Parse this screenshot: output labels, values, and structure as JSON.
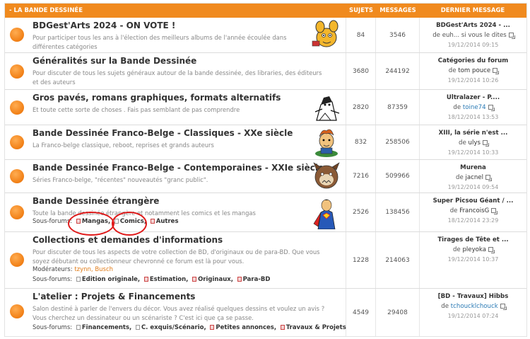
{
  "header": {
    "title": "- LA BANDE DESSINÉE",
    "col_sujets": "SUJETS",
    "col_messages": "MESSAGES",
    "col_last": "DERNIER MESSAGE"
  },
  "forums": [
    {
      "title": "BDGest'Arts 2024 - ON VOTE !",
      "desc": "Pour participer tous les ans à l'élection des meilleurs albums de l'année écoulée dans différentes catégories",
      "sujets": "84",
      "messages": "3546",
      "last_title": "BDGest'Arts 2024 - ...",
      "last_by": "de euh... si vous le dites",
      "last_date": "19/12/2014 09:15"
    },
    {
      "title": "Généralités sur la Bande Dessinée",
      "desc": "Pour discuter de tous les sujets généraux autour de la bande dessinée, des libraries, des éditeurs et des auteurs",
      "sujets": "3680",
      "messages": "244192",
      "last_title": "Catégories du forum",
      "last_prefix": "de",
      "last_user": "tom pouce",
      "last_date": "19/12/2014 10:26"
    },
    {
      "title": "Gros pavés, romans graphiques, formats alternatifs",
      "desc": "Et toute cette sorte de choses . Fais pas semblant de pas comprendre",
      "sujets": "2820",
      "messages": "87359",
      "last_title": "Ultralazer - P....",
      "last_prefix": "de",
      "last_user": "toine74",
      "last_date": "18/12/2014 13:53"
    },
    {
      "title": "Bande Dessinée Franco-Belge - Classiques - XXe siècle",
      "desc": "La Franco-belge classique, reboot, reprises et grands auteurs",
      "sujets": "832",
      "messages": "258506",
      "last_title": "XIII, la série n'est ...",
      "last_prefix": "de",
      "last_user": "ulys",
      "last_date": "19/12/2014 10:33"
    },
    {
      "title": "Bande Dessinée Franco-Belge - Contemporaines - XXIe siècle",
      "desc": "Séries Franco-belge, \"récentes\" nouveautés \"granc public\".",
      "sujets": "7216",
      "messages": "509966",
      "last_title": "Murena",
      "last_prefix": "de",
      "last_user": "jacnel",
      "last_date": "19/12/2014 09:54"
    },
    {
      "title": "Bande Dessinée étrangère",
      "desc": "Toute la bande dessinée étrangère et notamment les comics et les mangas",
      "subforums_label": "Sous-forums:",
      "subforums": [
        "Mangas,",
        "Comics,",
        "Autres"
      ],
      "sujets": "2526",
      "messages": "138456",
      "last_title": "Super Picsou Géant / ...",
      "last_prefix": "de",
      "last_user": "FrancoisG",
      "last_date": "18/12/2014 23:29"
    },
    {
      "title": "Collections et demandes d'informations",
      "desc": "Pour discuter de tous les aspects de votre collection de BD, d'originaux ou de para-BD. Que vous soyez débutant ou collectionneur chevronné ce forum est là pour vous.",
      "moderators_label": "Modérateurs:",
      "moderators": "tzynn, Busch",
      "subforums_label": "Sous-forums:",
      "subforums": [
        "Edition originale,",
        "Estimation,",
        "Originaux,",
        "Para-BD"
      ],
      "sujets": "1228",
      "messages": "214063",
      "last_title": "Tirages de Tête et ...",
      "last_prefix": "de",
      "last_user": "pleyoka",
      "last_date": "19/12/2014 10:37"
    },
    {
      "title": "L'atelier : Projets & Financements",
      "desc": "Salon destiné à parler de l'envers du décor. Vous avez réalisé quelques dessins et voulez un avis ? Vous cherchez un dessinateur ou un scénariste ? C'est ici que ça se passe.",
      "subforums_label": "Sous-forums:",
      "subforums": [
        "Financements,",
        "C. exquis/Scénario,",
        "Petites annonces,",
        "Travaux & Projets"
      ],
      "sujets": "4549",
      "messages": "29408",
      "last_title": "[BD - Travaux] Hibbs",
      "last_prefix": "de",
      "last_user": "tchoucklchouck",
      "last_date": "19/12/2014 07:24"
    }
  ],
  "colors": {
    "accent": "#f08a1e",
    "highlight_circle": "#e01b1b",
    "user_link": "#2a7ab5"
  }
}
